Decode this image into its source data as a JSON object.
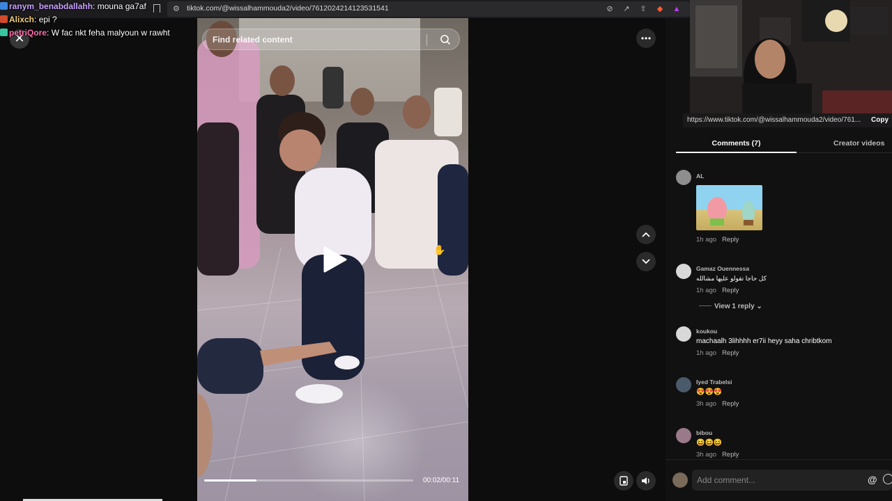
{
  "browser": {
    "url": "tiktok.com/@wissalhammouda2/video/7612024214123531541"
  },
  "chat": {
    "messages": [
      {
        "user": "ranym_benabdallahh",
        "text": "mouna ga7af",
        "color": "#c9a2ff",
        "badge_color": "#3b86e0"
      },
      {
        "user": "Alixch",
        "text": "epi ?",
        "color": "#f2d07a",
        "badge_color": "#d14a2b"
      },
      {
        "user": "petriQore",
        "text": "W fac nkt feha malyoun w rawht",
        "color": "#ff6fae",
        "badge_color": "#36c5a0"
      }
    ]
  },
  "video": {
    "search_placeholder": "Find related content",
    "time": "00:02/00:11",
    "progress": 0.25
  },
  "panel": {
    "share_link": "https://www.tiktok.com/@wissalhammouda2/video/761...",
    "copy_label": "Copy",
    "tabs": [
      {
        "label": "Comments (7)",
        "active": true
      },
      {
        "label": "Creator videos",
        "active": false
      }
    ],
    "comments": [
      {
        "name": "AL",
        "text": "",
        "time": "1h ago",
        "reply": "Reply",
        "has_sticker": true
      },
      {
        "name": "Gamaz Ouennessa",
        "text": "كل حاجا تقولو عليها مشالله",
        "time": "1h ago",
        "reply": "Reply"
      },
      {
        "name": "koukou",
        "text": "machaalh 3lihhhh er7ii heyy saha chribtkom",
        "time": "1h ago",
        "reply": "Reply"
      },
      {
        "name": "Iyed Trabelsi",
        "text": "😍😍😍",
        "time": "3h ago",
        "reply": "Reply"
      },
      {
        "name": "bibou",
        "text": "😆😆😆",
        "time": "3h ago",
        "reply": "Reply"
      }
    ],
    "view_replies": "View 1 reply",
    "add_comment_placeholder": "Add comment...",
    "at_symbol": "@"
  }
}
